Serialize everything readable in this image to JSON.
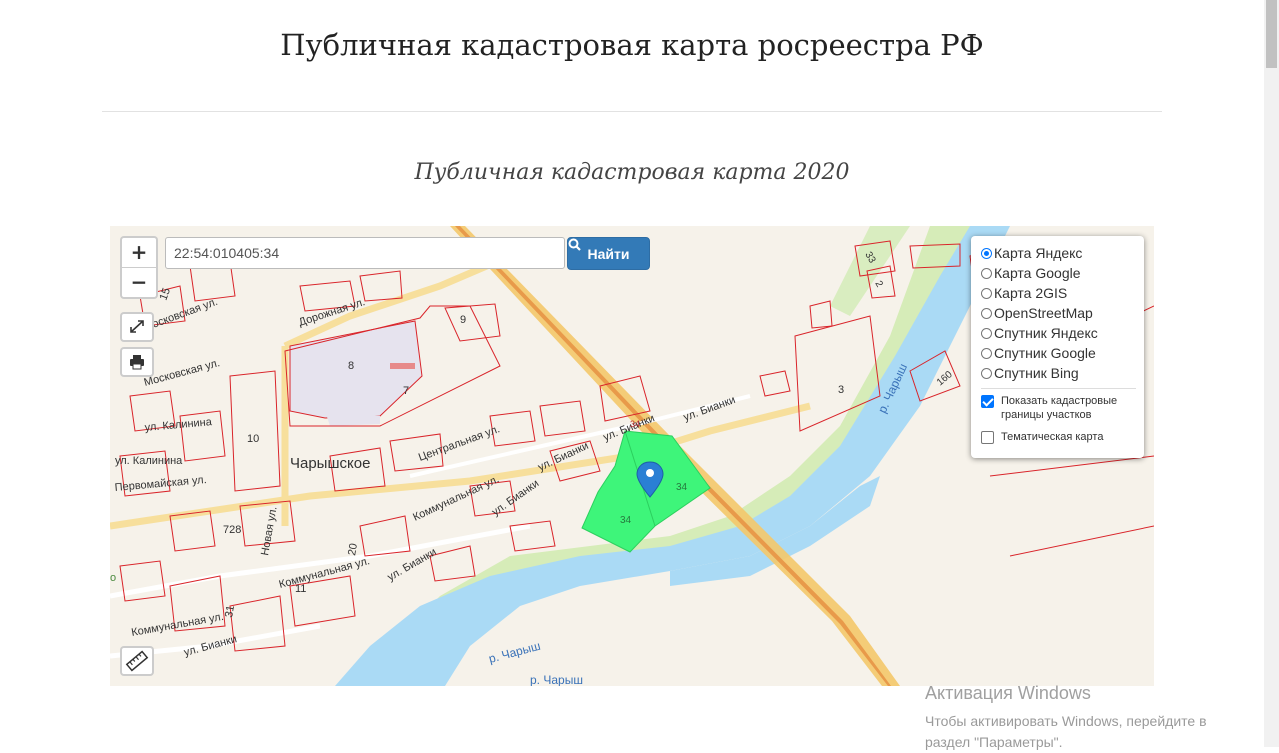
{
  "page": {
    "title": "Публичная кадастровая карта росреестра РФ",
    "subtitle": "Публичная кадастровая карта 2020"
  },
  "map": {
    "search": {
      "value": "22:54:010405:34",
      "button_label": "Найти"
    },
    "zoom_in": "+",
    "zoom_out": "−",
    "icons": [
      "expand-icon",
      "print-icon",
      "ruler-icon",
      "search-icon",
      "map-marker-icon"
    ],
    "layers": [
      {
        "label": "Карта Яндекс",
        "selected": true
      },
      {
        "label": "Карта Google",
        "selected": false
      },
      {
        "label": "Карта 2GIS",
        "selected": false
      },
      {
        "label": "OpenStreetMap",
        "selected": false
      },
      {
        "label": "Спутник Яндекс",
        "selected": false
      },
      {
        "label": "Спутник Google",
        "selected": false
      },
      {
        "label": "Спутник Bing",
        "selected": false
      }
    ],
    "options": [
      {
        "label": "Показать кадастровые границы участков",
        "checked": true
      },
      {
        "label": "Тематическая карта",
        "checked": false
      }
    ],
    "labels": {
      "village": "Чарышское",
      "river_1": "р. Чарыш",
      "river_2": "р. Чарыш",
      "river_3": "р. Чарыш",
      "street_doroznaya": "Дорожная ул.",
      "street_kalinina_1": "ул. Калинина",
      "street_kalinina_2": "ул. Калинина",
      "street_pervomayskaya": "Первомайская ул.",
      "street_moskovskaya_1": "Московская ул.",
      "street_moskovskaya_2": "Московская ул.",
      "street_centralnaya": "Центральная ул.",
      "street_kommunalnaya_1": "Коммунальная ул.",
      "street_kommunalnaya_2": "Коммунальная ул.",
      "street_kommunalnaya_3": "Коммунальная ул.",
      "street_bianki_1": "ул. Бианки",
      "street_bianki_2": "ул. Бианки",
      "street_bianki_3": "ул. Бианки",
      "street_bianki_4": "ул. Бианки",
      "street_bianki_5": "ул. Бианки",
      "street_bianki_6": "ул. Бианки",
      "street_novaya": "Новая ул.",
      "parcel_15": "15",
      "parcel_9": "9",
      "parcel_8": "8",
      "parcel_7": "7",
      "parcel_10": "10",
      "parcel_728": "728",
      "parcel_20": "20",
      "parcel_11": "11",
      "parcel_31": "31",
      "parcel_3": "3",
      "parcel_33": "33",
      "parcel_2": "2",
      "parcel_160": "160",
      "parcel_34a": "34",
      "parcel_34b": "34",
      "parcel_34c": "34",
      "edge_label": "о"
    },
    "colors": {
      "parcel_border": "#d9242a",
      "river": "#aadaf5",
      "selected_parcel": "#3ef57a",
      "road": "#f4c86a",
      "marker": "#2a7fd4"
    }
  },
  "watermark": {
    "title": "Активация Windows",
    "text": "Чтобы активировать Windows, перейдите в раздел \"Параметры\"."
  }
}
